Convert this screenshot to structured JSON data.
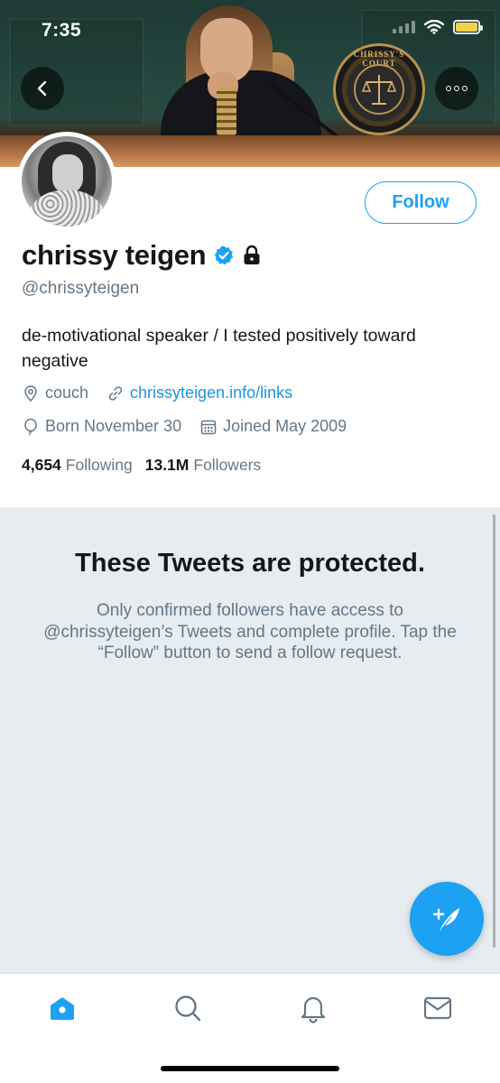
{
  "status_bar": {
    "time": "7:35"
  },
  "banner": {
    "seal_text": "CHRISSY'S COURT"
  },
  "header": {
    "back_icon": "chevron-left-icon",
    "more_icon": "more-dots-icon"
  },
  "profile": {
    "follow_label": "Follow",
    "name": "chrissy teigen",
    "handle": "@chrissyteigen",
    "bio": "de-motivational speaker / I tested positively toward negative",
    "location": "couch",
    "website": "chrissyteigen.info/links",
    "born": "Born November 30",
    "joined": "Joined May 2009",
    "following_count": "4,654",
    "following_label": "Following",
    "followers_count": "13.1M",
    "followers_label": "Followers"
  },
  "protected": {
    "title": "These Tweets are protected.",
    "body": "Only confirmed followers have access to @chrissyteigen’s Tweets and complete profile. Tap the “Follow” button to send a follow request."
  },
  "colors": {
    "accent": "#1da1f2",
    "link": "#1b95e0",
    "muted": "#657786",
    "protected_bg": "#e6ecf0"
  },
  "tab_bar": {
    "tabs": [
      {
        "icon": "home-icon",
        "active": true
      },
      {
        "icon": "search-icon",
        "active": false
      },
      {
        "icon": "notifications-bell-icon",
        "active": false
      },
      {
        "icon": "messages-envelope-icon",
        "active": false
      }
    ]
  }
}
